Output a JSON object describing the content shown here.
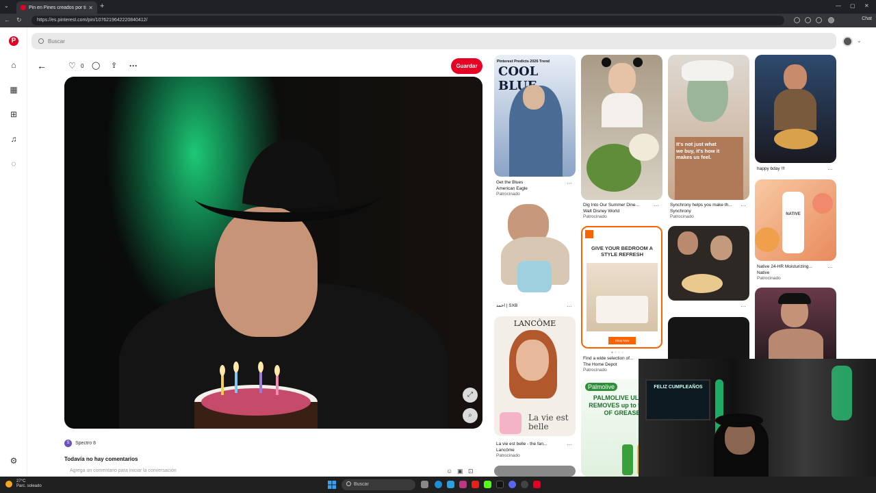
{
  "browser": {
    "tab_title": "Pin en Pines creados por ti",
    "url": "https://es.pinterest.com/pin/1076219642220840412/",
    "chat_label": "Chat"
  },
  "search": {
    "placeholder": "Buscar"
  },
  "pin": {
    "likes": "0",
    "save_label": "Guardar",
    "author": "Spectro 8",
    "author_initial": "S",
    "no_comments": "Todavía no hay comentarios",
    "add_comment_placeholder": "Agrega un comentario para iniciar la conversación"
  },
  "feed": [
    {
      "overlay_top": "Pinterest Predicts 2026 Trend",
      "overlay_title": "COOL BLUE",
      "title": "Get the Blues",
      "source": "American Eagle",
      "sponsored": "Patrocinado"
    },
    {
      "title": "Dig Into Our Summer Dine...",
      "source": "Walt Disney World",
      "sponsored": "Patrocinado"
    },
    {
      "overlay_text": "It's not just what we buy, it's how it makes us feel.",
      "title": "Synchrony helps you make th...",
      "source": "Synchrony",
      "sponsored": "Patrocinado"
    },
    {
      "title": "happy bday !!!"
    },
    {
      "title": "احمد | SXB"
    },
    {
      "overlay_title": "GIVE YOUR BEDROOM A STYLE REFRESH",
      "overlay_button": "Shop Now",
      "title": "Find a wide selection of...",
      "source": "The Home Depot",
      "sponsored": "Patrocinado"
    },
    {
      "title": ""
    },
    {
      "overlay_text": "NATIVE",
      "title": "Native 24-HR Moisturizing...",
      "source": "Native",
      "sponsored": "Patrocinado"
    },
    {
      "overlay_title": "LANCÔME",
      "overlay_text": "La vie est belle",
      "title": "La vie est belle - the fan...",
      "source": "Lancôme",
      "sponsored": "Patrocinado"
    },
    {
      "overlay_title": "Palmolive",
      "overlay_text": "PALMOLIVE ULTRA REMOVES up to 99.9% OF GREASE",
      "title": ""
    }
  ],
  "webcam": {
    "sign": "FELIZ CUMPLEAÑOS"
  },
  "taskbar": {
    "temp": "27°C",
    "weather": "Parc. soleado",
    "search_label": "Buscar"
  },
  "colors": {
    "brand": "#e60023",
    "chrome_dark": "#202124"
  }
}
